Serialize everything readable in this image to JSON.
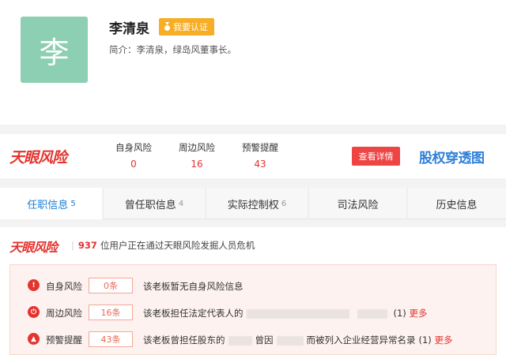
{
  "profile": {
    "avatar_char": "李",
    "name": "李清泉",
    "cert_label": "我要认证",
    "bio_label": "简介：",
    "bio_text": "李清泉，绿岛风董事长。"
  },
  "risk_bar": {
    "logo": "天眼风险",
    "stats": [
      {
        "label": "自身风险",
        "value": "0"
      },
      {
        "label": "周边风险",
        "value": "16"
      },
      {
        "label": "预警提醒",
        "value": "43"
      }
    ],
    "detail_button": "查看详情",
    "equity_logo": "股权穿透图"
  },
  "tabs": [
    {
      "label": "任职信息",
      "count": "5",
      "active": true
    },
    {
      "label": "曾任职信息",
      "count": "4",
      "active": false
    },
    {
      "label": "实际控制权",
      "count": "6",
      "active": false
    },
    {
      "label": "司法风险",
      "count": "",
      "active": false
    },
    {
      "label": "历史信息",
      "count": "",
      "active": false
    }
  ],
  "section": {
    "logo": "天眼风险",
    "user_count": "937",
    "warn_text": "位用户正在通过天眼风险发掘人员危机",
    "rows": [
      {
        "icon": "!",
        "label": "自身风险",
        "badge": "0条",
        "desc": "该老板暂无自身风险信息"
      },
      {
        "icon": "⏻",
        "label": "周边风险",
        "badge": "16条",
        "desc1": "该老板担任法定代表人的",
        "paren": "(1)",
        "more": "更多"
      },
      {
        "icon": "▲",
        "label": "预警提醒",
        "badge": "43条",
        "desc1": "该老板曾担任股东的",
        "desc2": "曾因",
        "desc3": "而被列入企业经营异常名录",
        "paren": "(1)",
        "more": "更多"
      }
    ]
  },
  "colors": {
    "accent_red": "#e3342f",
    "accent_blue": "#1a7fd4",
    "cert_orange": "#f7ad24",
    "avatar_green": "#8ccfb2"
  }
}
